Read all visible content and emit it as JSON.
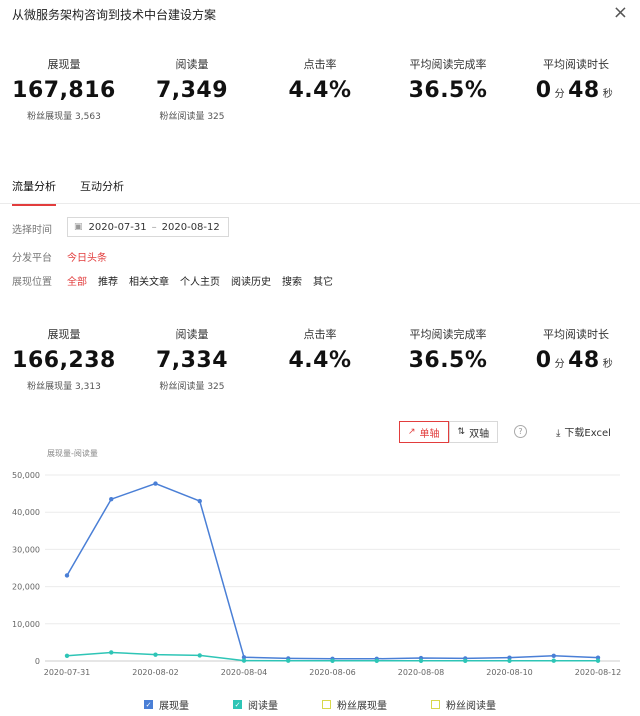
{
  "header": {
    "title": "从微服务架构咨询到技术中台建设方案",
    "close_label": "×"
  },
  "summary_top": [
    {
      "label": "展现量",
      "value": "167,816",
      "sub": "粉丝展现量 3,563"
    },
    {
      "label": "阅读量",
      "value": "7,349",
      "sub": "粉丝阅读量 325"
    },
    {
      "label": "点击率",
      "value": "4.4%",
      "sub": ""
    },
    {
      "label": "平均阅读完成率",
      "value": "36.5%",
      "sub": ""
    },
    {
      "label": "平均阅读时长",
      "value": "0",
      "unit1": "分",
      "value2": "48",
      "unit2": "秒",
      "sub": ""
    }
  ],
  "tabs": [
    {
      "label": "流量分析"
    },
    {
      "label": "互动分析"
    }
  ],
  "filters": {
    "time_label": "选择时间",
    "date_start": "2020-07-31",
    "date_sep": "–",
    "date_end": "2020-08-12",
    "calendar_icon": "calendar-icon",
    "platform_label": "分发平台",
    "platform_value": "今日头条",
    "position_label": "展现位置",
    "positions": [
      "全部",
      "推荐",
      "相关文章",
      "个人主页",
      "阅读历史",
      "搜索",
      "其它"
    ]
  },
  "summary_bottom": [
    {
      "label": "展现量",
      "value": "166,238",
      "sub": "粉丝展现量 3,313"
    },
    {
      "label": "阅读量",
      "value": "7,334",
      "sub": "粉丝阅读量 325"
    },
    {
      "label": "点击率",
      "value": "4.4%",
      "sub": ""
    },
    {
      "label": "平均阅读完成率",
      "value": "36.5%",
      "sub": ""
    },
    {
      "label": "平均阅读时长",
      "value": "0",
      "unit1": "分",
      "value2": "48",
      "unit2": "秒",
      "sub": ""
    }
  ],
  "controls": {
    "single_axis": "单轴",
    "dual_axis": "双轴",
    "help": "?",
    "download": "下载Excel"
  },
  "colors": {
    "accent": "#e23d3d",
    "series1": "#4a7fd6",
    "series2": "#2ec5b6",
    "grid": "#ebebeb"
  },
  "chart_data": {
    "type": "line",
    "title": "展现量-阅读量",
    "ylim": [
      0,
      50000
    ],
    "yticks": [
      0,
      10000,
      20000,
      30000,
      40000,
      50000
    ],
    "ytick_labels": [
      "0",
      "10,000",
      "20,000",
      "30,000",
      "40,000",
      "50,000"
    ],
    "x": [
      "2020-07-31",
      "2020-08-01",
      "2020-08-02",
      "2020-08-03",
      "2020-08-04",
      "2020-08-05",
      "2020-08-06",
      "2020-08-07",
      "2020-08-08",
      "2020-08-09",
      "2020-08-10",
      "2020-08-11",
      "2020-08-12"
    ],
    "xtick_labels": [
      "2020-07-31",
      "",
      "2020-08-02",
      "",
      "2020-08-04",
      "",
      "2020-08-06",
      "",
      "2020-08-08",
      "",
      "2020-08-10",
      "",
      "2020-08-12"
    ],
    "grid": true,
    "legend_position": "bottom",
    "series": [
      {
        "name": "展现量",
        "color": "#4a7fd6",
        "checked": true,
        "values": [
          23000,
          43500,
          47700,
          43000,
          1000,
          700,
          600,
          600,
          800,
          700,
          900,
          1400,
          900
        ]
      },
      {
        "name": "阅读量",
        "color": "#2ec5b6",
        "checked": true,
        "values": [
          1400,
          2300,
          1700,
          1500,
          100,
          80,
          60,
          60,
          60,
          60,
          60,
          80,
          70
        ]
      },
      {
        "name": "粉丝展现量",
        "color": "#d8d84a",
        "checked": false,
        "values": []
      },
      {
        "name": "粉丝阅读量",
        "color": "#d8d84a",
        "checked": false,
        "values": []
      }
    ]
  }
}
